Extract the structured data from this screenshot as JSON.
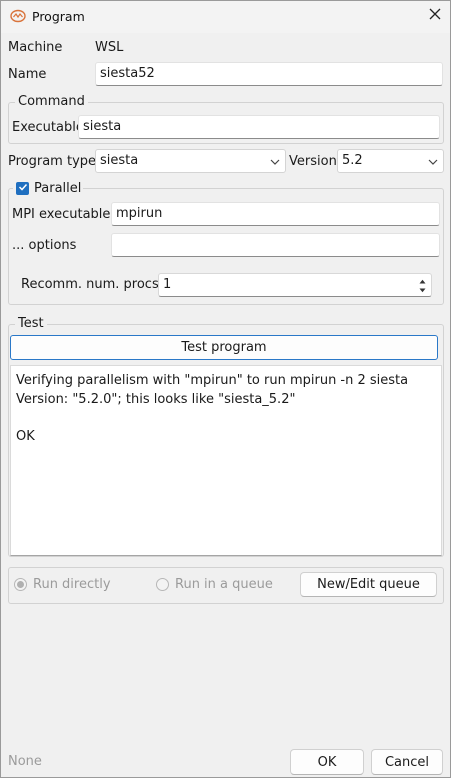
{
  "window": {
    "title": "Program"
  },
  "machine": {
    "label": "Machine",
    "value": "WSL"
  },
  "name": {
    "label": "Name",
    "value": "siesta52"
  },
  "command": {
    "group_title": "Command",
    "executable_label": "Executable",
    "executable_value": "siesta"
  },
  "program_type": {
    "label": "Program type",
    "selected": "siesta"
  },
  "version": {
    "label": "Version",
    "selected": "5.2"
  },
  "parallel": {
    "checkbox_label": "Parallel",
    "checked": true,
    "mpi_label": "MPI executable",
    "mpi_value": "mpirun",
    "options_label": "... options",
    "options_value": "",
    "procs_label": "Recomm. num. procs.",
    "procs_value": "1"
  },
  "test": {
    "group_title": "Test",
    "button_label": "Test program",
    "log_text": "Verifying parallelism with \"mpirun\" to run mpirun -n 2 siesta\nVersion: \"5.2.0\"; this looks like \"siesta_5.2\"\n\nOK"
  },
  "run": {
    "run_directly_label": "Run directly",
    "run_queue_label": "Run in a queue",
    "selected": "Run directly",
    "queue_button_label": "New/Edit queue"
  },
  "footer": {
    "status_text": "None",
    "ok_label": "OK",
    "cancel_label": "Cancel"
  },
  "colors": {
    "accent": "#1f6fc0",
    "focus_border": "#2a78c8",
    "disabled_text": "#9b9b9b"
  },
  "icons": {
    "app": "program-app-icon",
    "close": "close-icon",
    "chevron": "chevron-down-icon",
    "check": "checkmark-icon",
    "spin_up": "spin-up-icon",
    "spin_down": "spin-down-icon"
  }
}
